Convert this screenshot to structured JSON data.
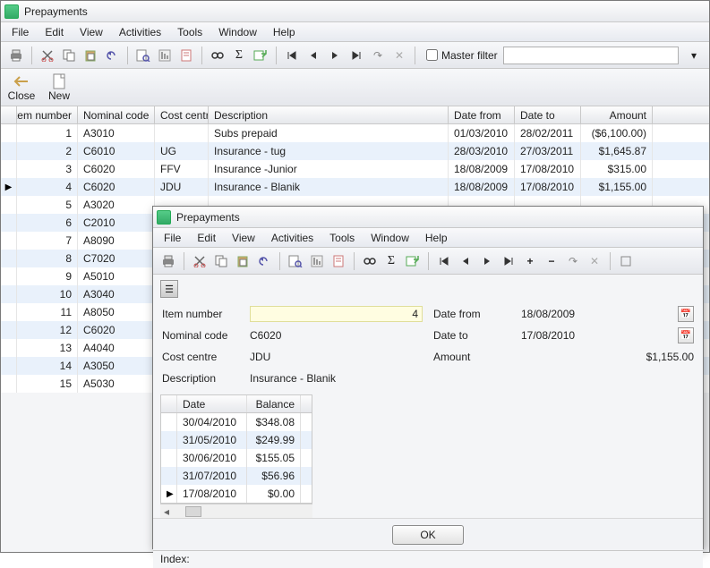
{
  "main": {
    "title": "Prepayments",
    "menu": [
      "File",
      "Edit",
      "View",
      "Activities",
      "Tools",
      "Window",
      "Help"
    ],
    "master_filter_label": "Master filter",
    "bigbuttons": {
      "close": "Close",
      "new": "New"
    },
    "columns": {
      "item": "Item number",
      "nom": "Nominal code",
      "cc": "Cost centre",
      "desc": "Description",
      "df": "Date from",
      "dt": "Date to",
      "amt": "Amount"
    },
    "rows": [
      {
        "n": "1",
        "nom": "A3010",
        "cc": "",
        "desc": "Subs prepaid",
        "df": "01/03/2010",
        "dt": "28/02/2011",
        "amt": "($6,100.00)"
      },
      {
        "n": "2",
        "nom": "C6010",
        "cc": "UG",
        "desc": "Insurance - tug",
        "df": "28/03/2010",
        "dt": "27/03/2011",
        "amt": "$1,645.87"
      },
      {
        "n": "3",
        "nom": "C6020",
        "cc": "FFV",
        "desc": "Insurance -Junior",
        "df": "18/08/2009",
        "dt": "17/08/2010",
        "amt": "$315.00"
      },
      {
        "n": "4",
        "nom": "C6020",
        "cc": "JDU",
        "desc": "Insurance - Blanik",
        "df": "18/08/2009",
        "dt": "17/08/2010",
        "amt": "$1,155.00",
        "ptr": true
      },
      {
        "n": "5",
        "nom": "A3020",
        "cc": "",
        "desc": "",
        "df": "",
        "dt": "",
        "amt": ""
      },
      {
        "n": "6",
        "nom": "C2010",
        "cc": "",
        "desc": "",
        "df": "",
        "dt": "",
        "amt": ""
      },
      {
        "n": "7",
        "nom": "A8090",
        "cc": "",
        "desc": "",
        "df": "",
        "dt": "",
        "amt": ""
      },
      {
        "n": "8",
        "nom": "C7020",
        "cc": "",
        "desc": "",
        "df": "",
        "dt": "",
        "amt": ""
      },
      {
        "n": "9",
        "nom": "A5010",
        "cc": "",
        "desc": "",
        "df": "",
        "dt": "",
        "amt": ""
      },
      {
        "n": "10",
        "nom": "A3040",
        "cc": "",
        "desc": "",
        "df": "",
        "dt": "",
        "amt": ""
      },
      {
        "n": "11",
        "nom": "A8050",
        "cc": "",
        "desc": "",
        "df": "",
        "dt": "",
        "amt": ""
      },
      {
        "n": "12",
        "nom": "C6020",
        "cc": "",
        "desc": "",
        "df": "",
        "dt": "",
        "amt": ""
      },
      {
        "n": "13",
        "nom": "A4040",
        "cc": "",
        "desc": "",
        "df": "",
        "dt": "",
        "amt": ""
      },
      {
        "n": "14",
        "nom": "A3050",
        "cc": "",
        "desc": "",
        "df": "",
        "dt": "",
        "amt": ""
      },
      {
        "n": "15",
        "nom": "A5030",
        "cc": "",
        "desc": "",
        "df": "",
        "dt": "",
        "amt": ""
      }
    ]
  },
  "sub": {
    "title": "Prepayments",
    "menu": [
      "File",
      "Edit",
      "View",
      "Activities",
      "Tools",
      "Window",
      "Help"
    ],
    "labels": {
      "item": "Item number",
      "nom": "Nominal code",
      "cc": "Cost centre",
      "desc": "Description",
      "df": "Date from",
      "dt": "Date to",
      "amt": "Amount"
    },
    "values": {
      "item": "4",
      "nom": "C6020",
      "cc": "JDU",
      "desc": "Insurance - Blanik",
      "df": "18/08/2009",
      "dt": "17/08/2010",
      "amt": "$1,155.00"
    },
    "gridcols": {
      "date": "Date",
      "bal": "Balance"
    },
    "gridrows": [
      {
        "date": "30/04/2010",
        "bal": "$348.08"
      },
      {
        "date": "31/05/2010",
        "bal": "$249.99"
      },
      {
        "date": "30/06/2010",
        "bal": "$155.05"
      },
      {
        "date": "31/07/2010",
        "bal": "$56.96"
      },
      {
        "date": "17/08/2010",
        "bal": "$0.00",
        "ptr": true
      }
    ],
    "ok": "OK",
    "status": "Index:"
  }
}
